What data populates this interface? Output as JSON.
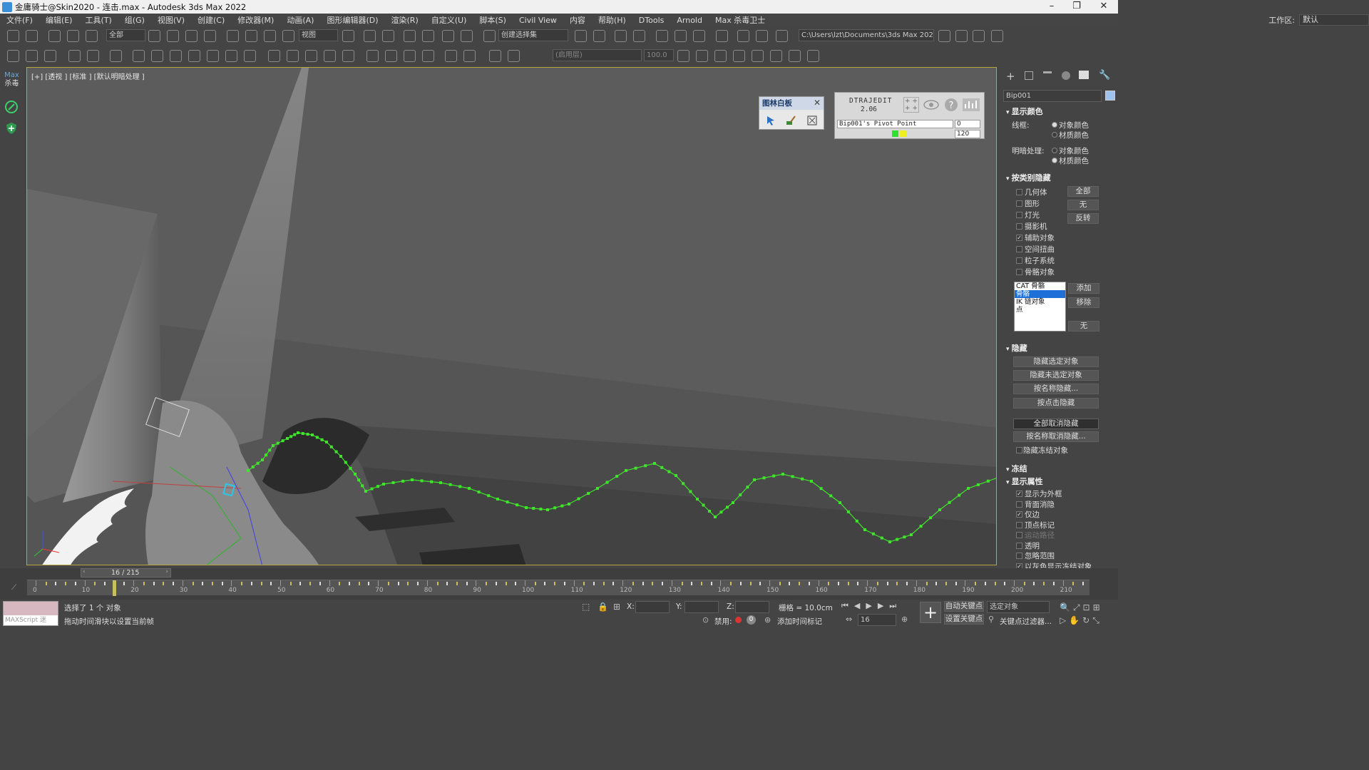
{
  "window": {
    "title": "金庸骑士@Skin2020 - 连击.max - Autodesk 3ds Max 2022",
    "controls": {
      "minimize": "–",
      "maximize": "❐",
      "close": "✕"
    }
  },
  "menu": {
    "items": [
      "文件(F)",
      "编辑(E)",
      "工具(T)",
      "组(G)",
      "视图(V)",
      "创建(C)",
      "修改器(M)",
      "动画(A)",
      "图形编辑器(D)",
      "渲染(R)",
      "自定义(U)",
      "脚本(S)",
      "Civil View",
      "内容",
      "帮助(H)",
      "DTools",
      "Arnold",
      "Max 杀毒卫士"
    ],
    "workspace_label": "工作区:",
    "workspace_value": "默认"
  },
  "toolbar1": {
    "filter_select": "全部",
    "view_select": "视图",
    "selection_set": "创建选择集",
    "path": "C:\\Users\\lzt\\Documents\\3ds Max 2022"
  },
  "toolbar2": {
    "layer_box": "(启用层)",
    "value_box": "100.0"
  },
  "leftstrip": {
    "logo_top": "Max",
    "logo_bottom": "杀毒"
  },
  "viewport": {
    "label": "[+] [透视 ] [标准 ] [默认明暗处理 ]"
  },
  "whiteboard": {
    "title": "图林白板"
  },
  "dtrajedit": {
    "title": "DTRAJEDIT",
    "version": "2.06",
    "pivot": "Bip001's Pivot Point",
    "frame_value": "0",
    "end_value": "120"
  },
  "cmdpanel": {
    "name_field": "Bip001",
    "display_color": {
      "title": "显示颜色",
      "wire_label": "线框:",
      "shaded_label": "明暗处理:",
      "opt_object": "对象颜色",
      "opt_material": "材质颜色"
    },
    "hide_by_category": {
      "title": "按类别隐藏",
      "items": [
        {
          "label": "几何体",
          "checked": false
        },
        {
          "label": "图形",
          "checked": false
        },
        {
          "label": "灯光",
          "checked": false
        },
        {
          "label": "摄影机",
          "checked": false
        },
        {
          "label": "辅助对象",
          "checked": true
        },
        {
          "label": "空间扭曲",
          "checked": false
        },
        {
          "label": "粒子系统",
          "checked": false
        },
        {
          "label": "骨骼对象",
          "checked": false
        }
      ],
      "btn_all": "全部",
      "btn_none": "无",
      "btn_invert": "反转",
      "list": [
        "CAT 骨骼",
        "骨骼",
        "IK 链对象",
        "点"
      ],
      "btn_add": "添加",
      "btn_remove": "移除",
      "btn_none2": "无"
    },
    "hide": {
      "title": "隐藏",
      "buttons": [
        "隐藏选定对象",
        "隐藏未选定对象",
        "按名称隐藏...",
        "按点击隐藏",
        "全部取消隐藏",
        "按名称取消隐藏..."
      ],
      "frozen_label": "隐藏冻结对象"
    },
    "freeze": {
      "title": "冻结"
    },
    "display_props": {
      "title": "显示属性",
      "items": [
        {
          "label": "显示为外框",
          "checked": true
        },
        {
          "label": "背面消隐",
          "checked": false
        },
        {
          "label": "仅边",
          "checked": true
        },
        {
          "label": "顶点标记",
          "checked": false
        },
        {
          "label": "运动路径",
          "checked": false
        },
        {
          "label": "透明",
          "checked": false
        },
        {
          "label": "忽略范围",
          "checked": false
        },
        {
          "label": "以灰色显示冻结对象",
          "checked": true
        }
      ]
    }
  },
  "timeline": {
    "slider_label": "16 / 215",
    "ticks": [
      "0",
      "10",
      "20",
      "30",
      "40",
      "50",
      "60",
      "70",
      "80",
      "90",
      "100",
      "110",
      "120",
      "130",
      "140",
      "150",
      "160",
      "170",
      "180",
      "190",
      "200",
      "210"
    ]
  },
  "status": {
    "script_label": "MAXScript 迷",
    "selected": "选择了 1 个 对象",
    "hint": "拖动时间滑块以设置当前帧",
    "x_label": "X:",
    "y_label": "Y:",
    "z_label": "Z:",
    "grid": "栅格 = 10.0cm",
    "disabled_label": "禁用:",
    "add_time_tag": "添加时间标记",
    "auto_key": "自动关键点",
    "set_key": "设置关键点",
    "selected_obj": "选定对象",
    "key_filter": "关键点过滤器...",
    "frame_field": "16"
  },
  "colors": {
    "trajectory": "#3ee52b",
    "accent_blue": "#1e6fd8",
    "viewport_border": "#b5a643"
  }
}
